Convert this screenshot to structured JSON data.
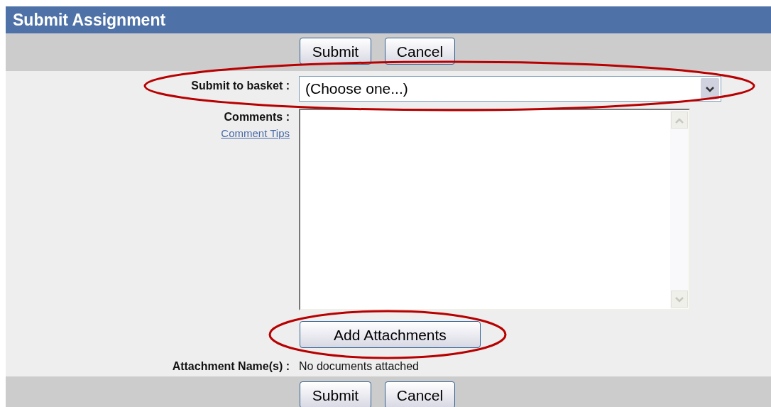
{
  "title": "Submit Assignment",
  "top_buttons": [
    "Submit",
    "Cancel"
  ],
  "basket": {
    "label": "Submit to basket :",
    "value": "(Choose one...)"
  },
  "comments": {
    "label": "Comments :",
    "link": "Comment Tips"
  },
  "add_button": "Add Attachments",
  "attachments": {
    "label": "Attachment Name(s) :",
    "value": "No documents attached"
  },
  "bottom_buttons": [
    "Submit",
    "Cancel"
  ]
}
